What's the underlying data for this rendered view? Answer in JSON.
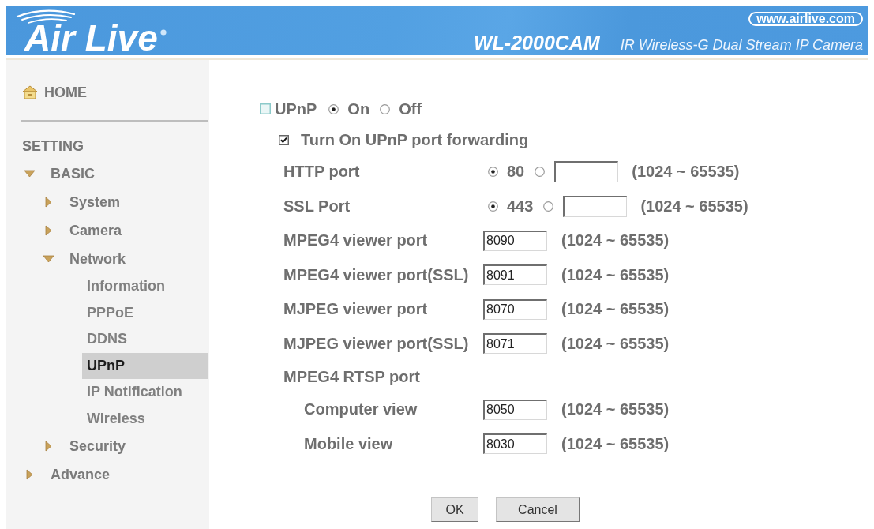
{
  "header": {
    "logo": "Air Live",
    "website": "www.airlive.com",
    "model": "WL-2000CAM",
    "description": "IR Wireless-G Dual Stream IP Camera"
  },
  "sidebar": {
    "home": "HOME",
    "section": "SETTING",
    "items": [
      {
        "kind": "folder",
        "label": "BASIC",
        "expanded": true,
        "children": [
          {
            "kind": "folder",
            "label": "System",
            "expanded": false
          },
          {
            "kind": "folder",
            "label": "Camera",
            "expanded": false
          },
          {
            "kind": "folder",
            "label": "Network",
            "expanded": true,
            "children": [
              {
                "kind": "page",
                "label": "Information",
                "selected": false
              },
              {
                "kind": "page",
                "label": "PPPoE",
                "selected": false
              },
              {
                "kind": "page",
                "label": "DDNS",
                "selected": false
              },
              {
                "kind": "page",
                "label": "UPnP",
                "selected": true
              },
              {
                "kind": "page",
                "label": "IP Notification",
                "selected": false
              },
              {
                "kind": "page",
                "label": "Wireless",
                "selected": false
              }
            ]
          },
          {
            "kind": "folder",
            "label": "Security",
            "expanded": false
          }
        ]
      },
      {
        "kind": "folder",
        "label": "Advance",
        "expanded": false
      }
    ]
  },
  "upnp": {
    "label": "UPnP",
    "options": [
      {
        "label": "On",
        "selected": true
      },
      {
        "label": "Off",
        "selected": false
      }
    ]
  },
  "port_forwarding": {
    "label": "Turn On UPnP port forwarding",
    "checked": true
  },
  "ports": [
    {
      "kind": "choice",
      "label": "HTTP port",
      "options": [
        {
          "kind": "fixed",
          "label": "80",
          "selected": true
        },
        {
          "kind": "custom",
          "selected": false
        }
      ],
      "range": "(1024 ~ 65535)"
    },
    {
      "kind": "choice",
      "label": "SSL Port",
      "options": [
        {
          "kind": "fixed",
          "label": "443",
          "selected": true
        },
        {
          "kind": "custom",
          "selected": false
        }
      ],
      "range": "(1024 ~ 65535)"
    },
    {
      "kind": "field",
      "label": "MPEG4 viewer port",
      "value": "8090",
      "range": "(1024 ~ 65535)"
    },
    {
      "kind": "field",
      "label": "MPEG4 viewer port(SSL)",
      "value": "8091",
      "range": "(1024 ~ 65535)"
    },
    {
      "kind": "field",
      "label": "MJPEG viewer port",
      "value": "8070",
      "range": "(1024 ~ 65535)"
    },
    {
      "kind": "field",
      "label": "MJPEG viewer port(SSL)",
      "value": "8071",
      "range": "(1024 ~ 65535)"
    },
    {
      "kind": "group",
      "label": "MPEG4 RTSP port",
      "children": [
        {
          "kind": "field",
          "label": "Computer view",
          "value": "8050",
          "range": "(1024 ~ 65535)"
        },
        {
          "kind": "field",
          "label": "Mobile view",
          "value": "8030",
          "range": "(1024 ~ 65535)"
        }
      ]
    }
  ],
  "buttons": [
    {
      "kind": "submit",
      "label": "OK"
    },
    {
      "kind": "cancel",
      "label": "Cancel"
    }
  ]
}
